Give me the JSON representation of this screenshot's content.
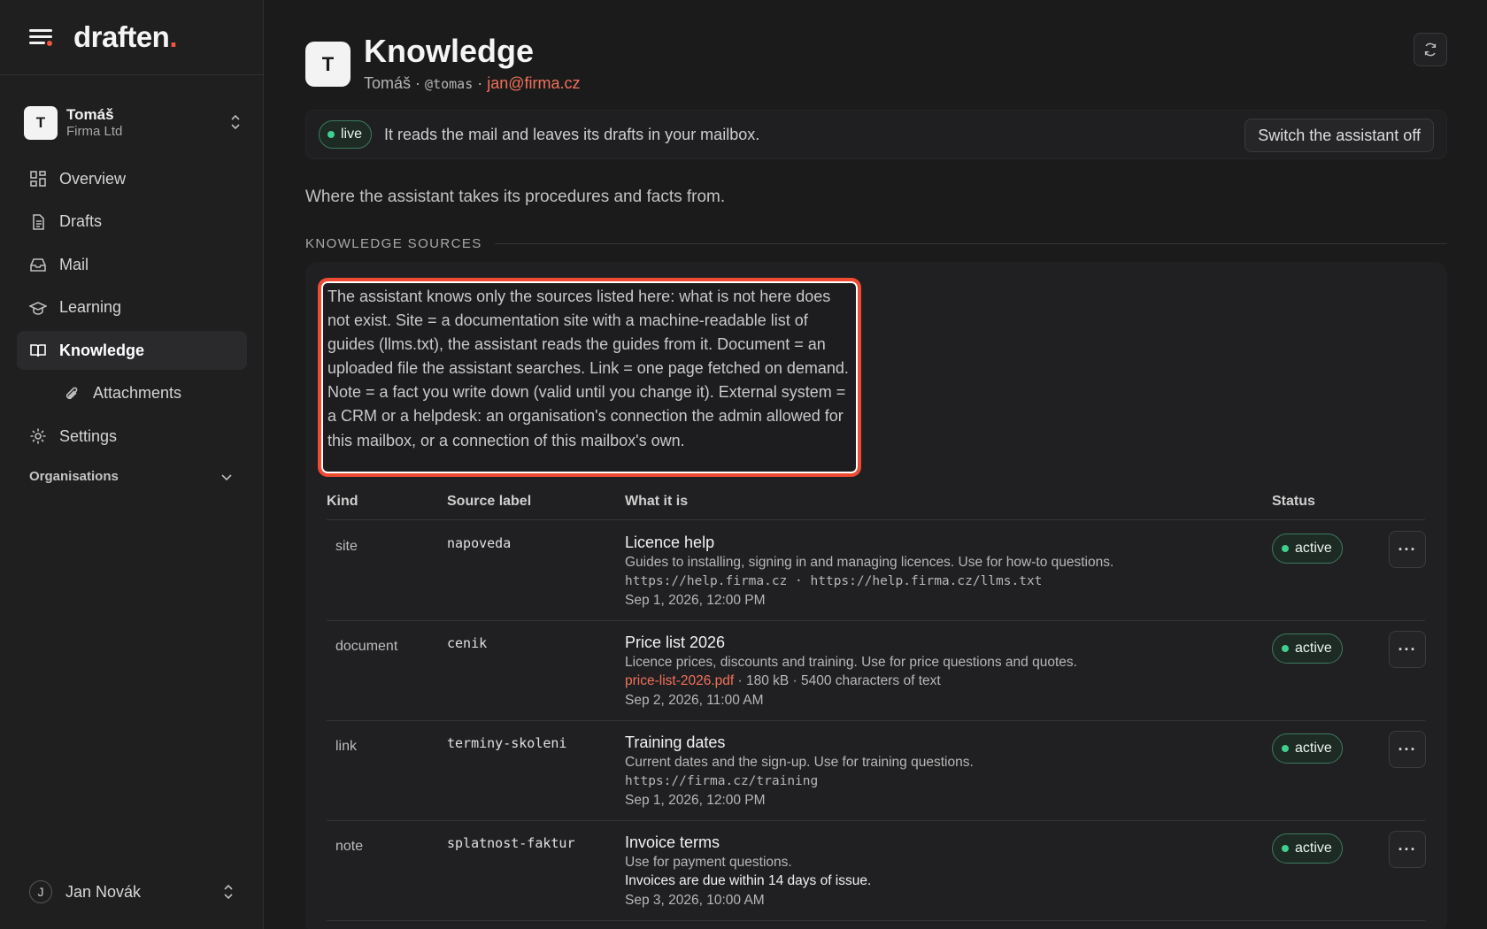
{
  "brand": {
    "name": "draften",
    "dot": "."
  },
  "account": {
    "initial": "T",
    "name": "Tomáš",
    "org": "Firma Ltd"
  },
  "nav": {
    "overview": "Overview",
    "drafts": "Drafts",
    "mail": "Mail",
    "learning": "Learning",
    "knowledge": "Knowledge",
    "attachments": "Attachments",
    "settings": "Settings",
    "organisations": "Organisations"
  },
  "user": {
    "initial": "J",
    "name": "Jan Novák"
  },
  "header": {
    "initial": "T",
    "title": "Knowledge",
    "owner": "Tomáš",
    "separator": "·",
    "handle": "@tomas",
    "email": "jan@firma.cz"
  },
  "banner": {
    "status": "live",
    "text": "It reads the mail and leaves its drafts in your mailbox.",
    "switch_label": "Switch the assistant off"
  },
  "intro": "Where the assistant takes its procedures and facts from.",
  "section_title": "KNOWLEDGE SOURCES",
  "help_text": "The assistant knows only the sources listed here: what is not here does not exist. Site = a documentation site with a machine-readable list of guides (llms.txt), the assistant reads the guides from it. Document = an uploaded file the assistant searches. Link = one page fetched on demand. Note = a fact you write down (valid until you change it). External system = a CRM or a helpdesk: an organisation's connection the admin allowed for this mailbox, or a connection of this mailbox's own.",
  "table": {
    "columns": {
      "kind": "Kind",
      "label": "Source label",
      "what": "What it is",
      "status": "Status"
    },
    "rows": [
      {
        "kind": "site",
        "label": "napoveda",
        "title": "Licence help",
        "description": "Guides to installing, signing in and managing licences. Use for how-to questions.",
        "meta": "https://help.firma.cz · https://help.firma.cz/llms.txt",
        "date": "Sep 1, 2026, 12:00 PM",
        "status": "active",
        "more": "···"
      },
      {
        "kind": "document",
        "label": "cenik",
        "title": "Price list 2026",
        "description": "Licence prices, discounts and training. Use for price questions and quotes.",
        "file": "price-list-2026.pdf",
        "meta": " · 180 kB · 5400 characters of text",
        "date": "Sep 2, 2026, 11:00 AM",
        "status": "active",
        "more": "···"
      },
      {
        "kind": "link",
        "label": "terminy-skoleni",
        "title": "Training dates",
        "description": "Current dates and the sign-up. Use for training questions.",
        "meta": "https://firma.cz/training",
        "date": "Sep 1, 2026, 12:00 PM",
        "status": "active",
        "more": "···"
      },
      {
        "kind": "note",
        "label": "splatnost-faktur",
        "title": "Invoice terms",
        "description": "Use for payment questions.",
        "note": "Invoices are due within 14 days of issue.",
        "date": "Sep 3, 2026, 10:00 AM",
        "status": "active",
        "more": "···"
      }
    ]
  },
  "colors": {
    "accent": "#f0553f",
    "active_green": "#3fcf8e",
    "link_orange": "#f0715a"
  }
}
